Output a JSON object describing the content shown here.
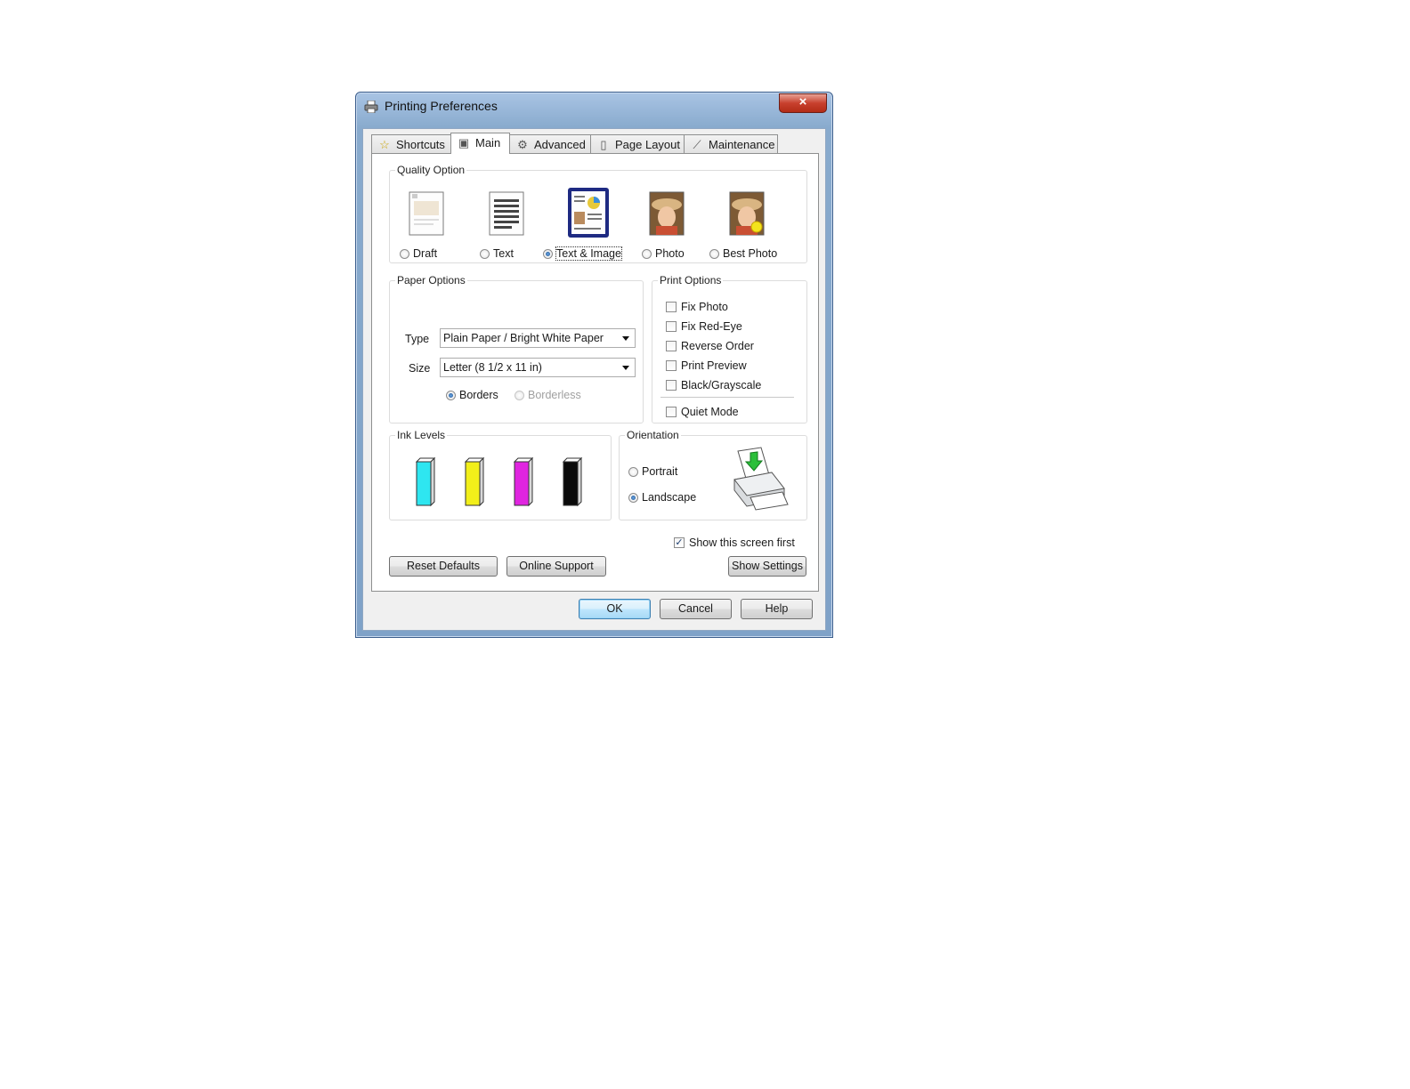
{
  "window": {
    "title": "Printing Preferences",
    "close_glyph": "×"
  },
  "tabs": [
    {
      "label": "Shortcuts",
      "icon": "star-icon"
    },
    {
      "label": "Main",
      "icon": "printer-icon",
      "active": true
    },
    {
      "label": "Advanced",
      "icon": "gears-icon"
    },
    {
      "label": "Page Layout",
      "icon": "page-icon"
    },
    {
      "label": "Maintenance",
      "icon": "wrench-icon"
    }
  ],
  "quality": {
    "legend": "Quality Option",
    "options": [
      {
        "label": "Draft",
        "selected": false
      },
      {
        "label": "Text",
        "selected": false
      },
      {
        "label": "Text & Image",
        "selected": true
      },
      {
        "label": "Photo",
        "selected": false
      },
      {
        "label": "Best Photo",
        "selected": false
      }
    ]
  },
  "paper": {
    "legend": "Paper Options",
    "type_label": "Type",
    "type_value": "Plain Paper / Bright White Paper",
    "size_label": "Size",
    "size_value": "Letter (8 1/2 x 11 in)",
    "borders_label": "Borders",
    "borderless_label": "Borderless",
    "borders_selected": true
  },
  "print_options": {
    "legend": "Print Options",
    "items": [
      {
        "label": "Fix Photo",
        "checked": false
      },
      {
        "label": "Fix Red-Eye",
        "checked": false
      },
      {
        "label": "Reverse Order",
        "checked": false
      },
      {
        "label": "Print Preview",
        "checked": false
      },
      {
        "label": "Black/Grayscale",
        "checked": false
      }
    ],
    "quiet_mode_label": "Quiet Mode",
    "quiet_mode_checked": false
  },
  "ink": {
    "legend": "Ink Levels",
    "cartridges": [
      {
        "color": "#2ee6f0",
        "name": "cyan"
      },
      {
        "color": "#f2ef1a",
        "name": "yellow"
      },
      {
        "color": "#e025e0",
        "name": "magenta"
      },
      {
        "color": "#0a0a0a",
        "name": "black"
      }
    ]
  },
  "orientation": {
    "legend": "Orientation",
    "portrait_label": "Portrait",
    "landscape_label": "Landscape",
    "selected": "Landscape"
  },
  "show_first": {
    "label": "Show this screen first",
    "checked": true,
    "check_glyph": "✓"
  },
  "buttons": {
    "reset": "Reset Defaults",
    "online": "Online Support",
    "show_settings": "Show Settings",
    "ok": "OK",
    "cancel": "Cancel",
    "help": "Help"
  }
}
